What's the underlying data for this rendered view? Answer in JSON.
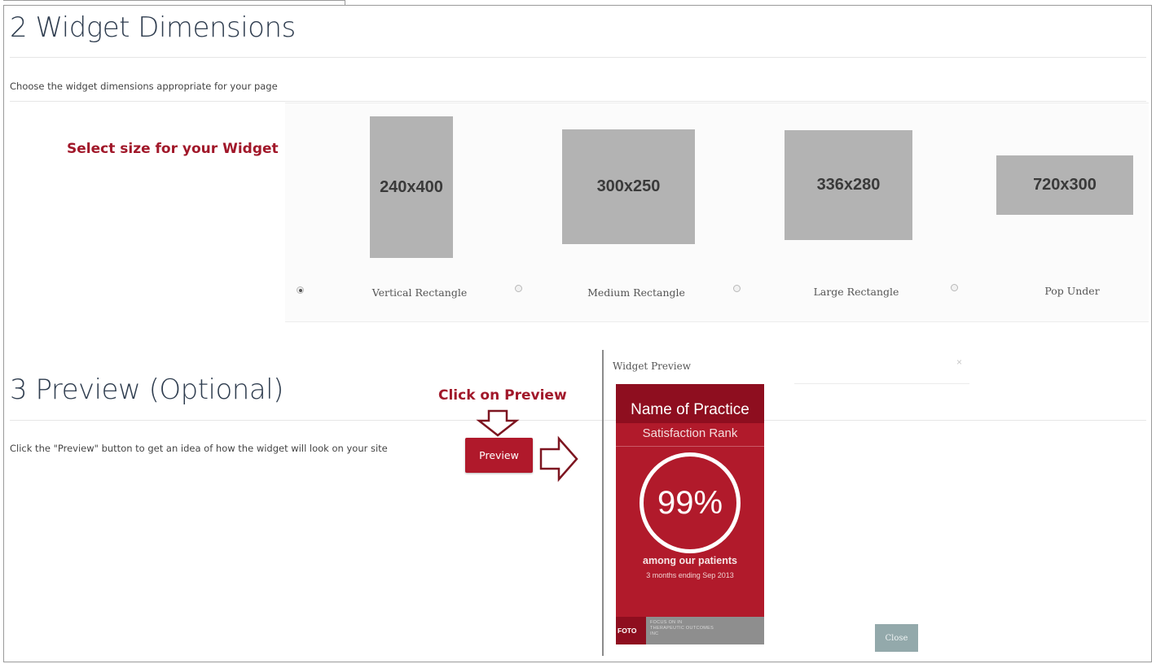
{
  "section2": {
    "title": "2 Widget Dimensions",
    "description": "Choose the widget dimensions appropriate for your page",
    "annotation": "Select size for your Widget",
    "options": [
      {
        "size": "240x400",
        "label": "Vertical Rectangle",
        "selected": true
      },
      {
        "size": "300x250",
        "label": "Medium Rectangle",
        "selected": false
      },
      {
        "size": "336x280",
        "label": "Large Rectangle",
        "selected": false
      },
      {
        "size": "720x300",
        "label": "Pop Under",
        "selected": false
      }
    ]
  },
  "section3": {
    "title": "3 Preview (Optional)",
    "description": "Click the \"Preview\" button to get an idea of how the widget will look on your site",
    "annotation": "Click on Preview",
    "preview_label": "Preview"
  },
  "modal": {
    "title": "Widget Preview",
    "close_x": "×",
    "close_label": "Close",
    "widget": {
      "practice_name": "Name of Practice",
      "rank_label": "Satisfaction Rank",
      "percent": "99%",
      "among": "among our patients",
      "period": "3 months ending Sep 2013",
      "brand": "FOTO",
      "brand_text": "FOCUS ON IN THERAPEUTIC OUTCOMES INC"
    }
  },
  "colors": {
    "brand_red": "#b0192b",
    "dark_red": "#8e0e1f",
    "placeholder_gray": "#b3b3b3",
    "close_button": "#93a9ab",
    "heading": "#2f3d4f"
  }
}
